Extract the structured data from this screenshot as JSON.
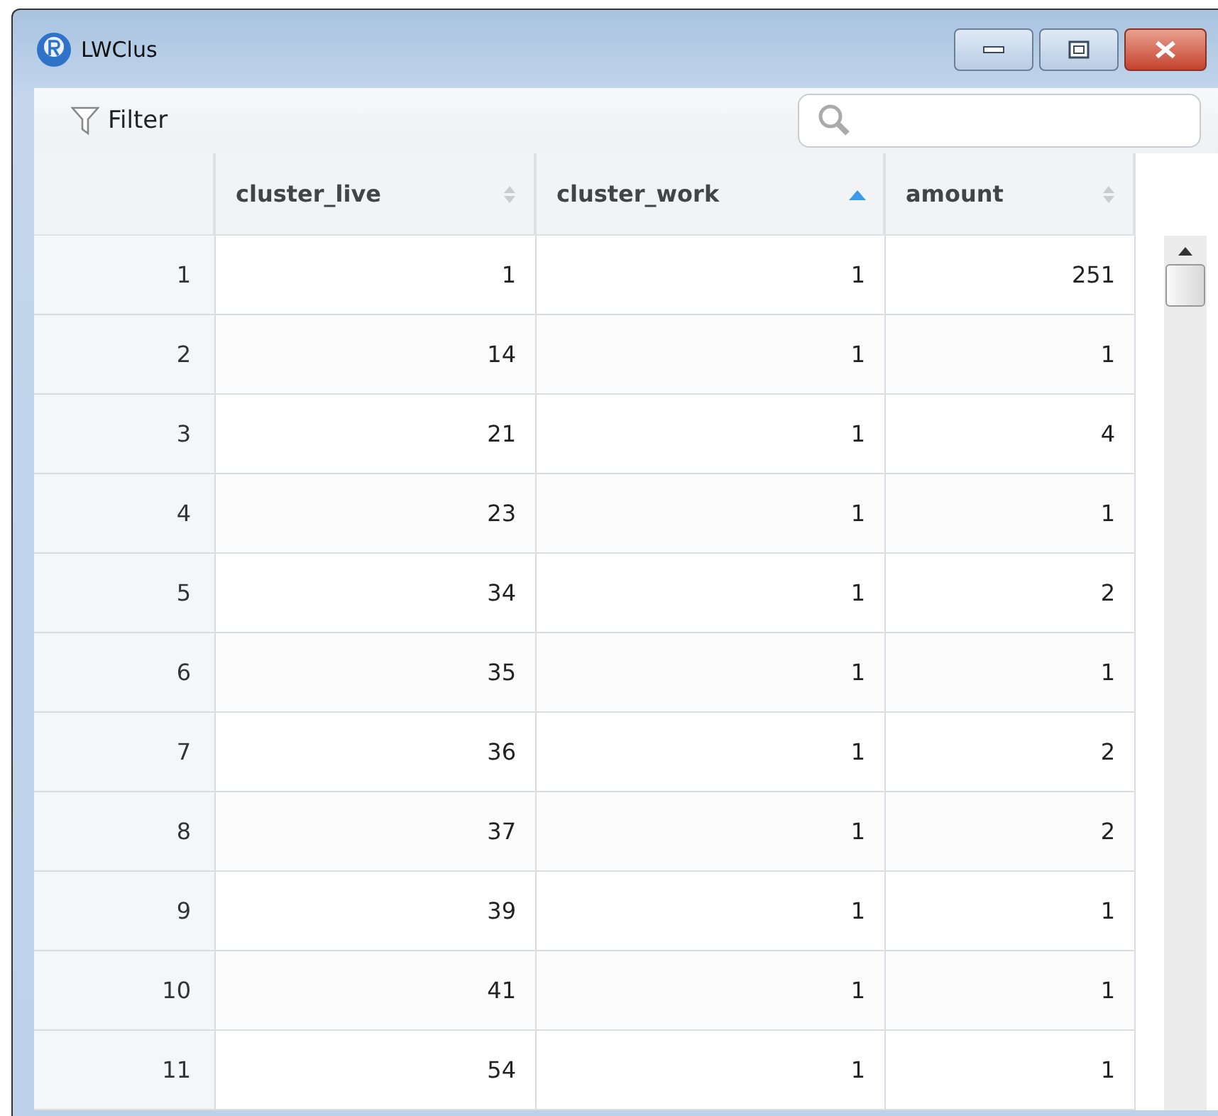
{
  "window": {
    "title": "LWClus"
  },
  "toolbar": {
    "filter_label": "Filter"
  },
  "table": {
    "columns": [
      {
        "label": "cluster_live",
        "sorted": false
      },
      {
        "label": "cluster_work",
        "sorted": true
      },
      {
        "label": "amount",
        "sorted": false
      }
    ],
    "rows": [
      {
        "index": "1",
        "cells": [
          "1",
          "1",
          "251"
        ]
      },
      {
        "index": "2",
        "cells": [
          "14",
          "1",
          "1"
        ]
      },
      {
        "index": "3",
        "cells": [
          "21",
          "1",
          "4"
        ]
      },
      {
        "index": "4",
        "cells": [
          "23",
          "1",
          "1"
        ]
      },
      {
        "index": "5",
        "cells": [
          "34",
          "1",
          "2"
        ]
      },
      {
        "index": "6",
        "cells": [
          "35",
          "1",
          "1"
        ]
      },
      {
        "index": "7",
        "cells": [
          "36",
          "1",
          "2"
        ]
      },
      {
        "index": "8",
        "cells": [
          "37",
          "1",
          "2"
        ]
      },
      {
        "index": "9",
        "cells": [
          "39",
          "1",
          "1"
        ]
      },
      {
        "index": "10",
        "cells": [
          "41",
          "1",
          "1"
        ]
      },
      {
        "index": "11",
        "cells": [
          "54",
          "1",
          "1"
        ]
      }
    ]
  }
}
